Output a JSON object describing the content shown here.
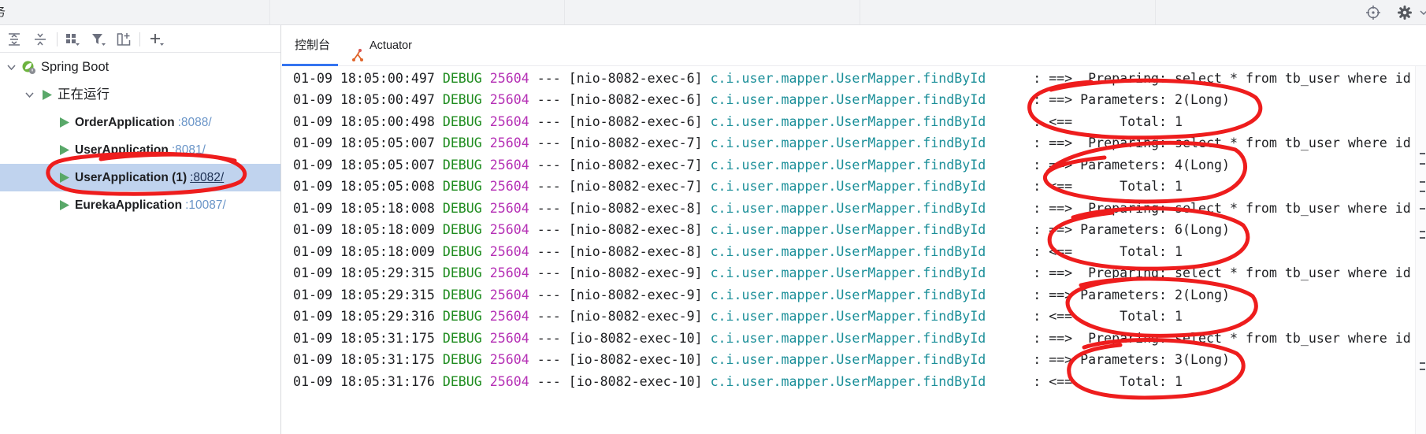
{
  "colors": {
    "text": "#1e1f22",
    "level": "#1f8c1f",
    "pid": "#b530b5",
    "logger": "#1b8f99",
    "port": "#6a95c8",
    "port_selected": "#1c2f52",
    "selection": "#c0d3ee",
    "play": "#59a869",
    "tab_indicator": "#3574f0",
    "annotation": "#ee1d1d",
    "actuator": "#e0662c"
  },
  "top_bar": {
    "title_fragment": "务",
    "icons": [
      "crosshair-icon",
      "gear-icon",
      "chevron-down-icon"
    ]
  },
  "services_toolbar": {
    "icons": [
      "expand-all-icon",
      "collapse-all-icon",
      "group-by-icon",
      "filter-icon",
      "new-service-icon",
      "add-icon"
    ]
  },
  "tree": {
    "root_label": "Spring Boot",
    "group_label": "正在运行",
    "apps": [
      {
        "name": "OrderApplication",
        "port": ":8088/",
        "selected": false
      },
      {
        "name": "UserApplication",
        "port": ":8081/",
        "selected": false
      },
      {
        "name": "UserApplication (1)",
        "port": ":8082/",
        "selected": true
      },
      {
        "name": "EurekaApplication",
        "port": ":10087/",
        "selected": false
      }
    ]
  },
  "tabs": [
    {
      "label": "控制台",
      "active": true
    },
    {
      "label": "Actuator",
      "active": false
    }
  ],
  "console": {
    "separator": "---",
    "delimiter": ":",
    "lines": [
      {
        "time": "01-09 18:05:00:497",
        "level": "DEBUG",
        "pid": "25604",
        "thread": "[nio-8082-exec-6]",
        "logger": "c.i.user.mapper.UserMapper.findById",
        "message": "==>  Preparing: select * from tb_user where id"
      },
      {
        "time": "01-09 18:05:00:497",
        "level": "DEBUG",
        "pid": "25604",
        "thread": "[nio-8082-exec-6]",
        "logger": "c.i.user.mapper.UserMapper.findById",
        "message": "==> Parameters: 2(Long)"
      },
      {
        "time": "01-09 18:05:00:498",
        "level": "DEBUG",
        "pid": "25604",
        "thread": "[nio-8082-exec-6]",
        "logger": "c.i.user.mapper.UserMapper.findById",
        "message": "<==      Total: 1"
      },
      {
        "time": "01-09 18:05:05:007",
        "level": "DEBUG",
        "pid": "25604",
        "thread": "[nio-8082-exec-7]",
        "logger": "c.i.user.mapper.UserMapper.findById",
        "message": "==>  Preparing: select * from tb_user where id"
      },
      {
        "time": "01-09 18:05:05:007",
        "level": "DEBUG",
        "pid": "25604",
        "thread": "[nio-8082-exec-7]",
        "logger": "c.i.user.mapper.UserMapper.findById",
        "message": "==> Parameters: 4(Long)"
      },
      {
        "time": "01-09 18:05:05:008",
        "level": "DEBUG",
        "pid": "25604",
        "thread": "[nio-8082-exec-7]",
        "logger": "c.i.user.mapper.UserMapper.findById",
        "message": "<==      Total: 1"
      },
      {
        "time": "01-09 18:05:18:008",
        "level": "DEBUG",
        "pid": "25604",
        "thread": "[nio-8082-exec-8]",
        "logger": "c.i.user.mapper.UserMapper.findById",
        "message": "==>  Preparing: select * from tb_user where id"
      },
      {
        "time": "01-09 18:05:18:009",
        "level": "DEBUG",
        "pid": "25604",
        "thread": "[nio-8082-exec-8]",
        "logger": "c.i.user.mapper.UserMapper.findById",
        "message": "==> Parameters: 6(Long)"
      },
      {
        "time": "01-09 18:05:18:009",
        "level": "DEBUG",
        "pid": "25604",
        "thread": "[nio-8082-exec-8]",
        "logger": "c.i.user.mapper.UserMapper.findById",
        "message": "<==      Total: 1"
      },
      {
        "time": "01-09 18:05:29:315",
        "level": "DEBUG",
        "pid": "25604",
        "thread": "[nio-8082-exec-9]",
        "logger": "c.i.user.mapper.UserMapper.findById",
        "message": "==>  Preparing: select * from tb_user where id"
      },
      {
        "time": "01-09 18:05:29:315",
        "level": "DEBUG",
        "pid": "25604",
        "thread": "[nio-8082-exec-9]",
        "logger": "c.i.user.mapper.UserMapper.findById",
        "message": "==> Parameters: 2(Long)"
      },
      {
        "time": "01-09 18:05:29:316",
        "level": "DEBUG",
        "pid": "25604",
        "thread": "[nio-8082-exec-9]",
        "logger": "c.i.user.mapper.UserMapper.findById",
        "message": "<==      Total: 1"
      },
      {
        "time": "01-09 18:05:31:175",
        "level": "DEBUG",
        "pid": "25604",
        "thread": "[io-8082-exec-10]",
        "logger": "c.i.user.mapper.UserMapper.findById",
        "message": "==>  Preparing: select * from tb_user where id"
      },
      {
        "time": "01-09 18:05:31:175",
        "level": "DEBUG",
        "pid": "25604",
        "thread": "[io-8082-exec-10]",
        "logger": "c.i.user.mapper.UserMapper.findById",
        "message": "==> Parameters: 3(Long)"
      },
      {
        "time": "01-09 18:05:31:176",
        "level": "DEBUG",
        "pid": "25604",
        "thread": "[io-8082-exec-10]",
        "logger": "c.i.user.mapper.UserMapper.findById",
        "message": "<==      Total: 1"
      }
    ]
  }
}
